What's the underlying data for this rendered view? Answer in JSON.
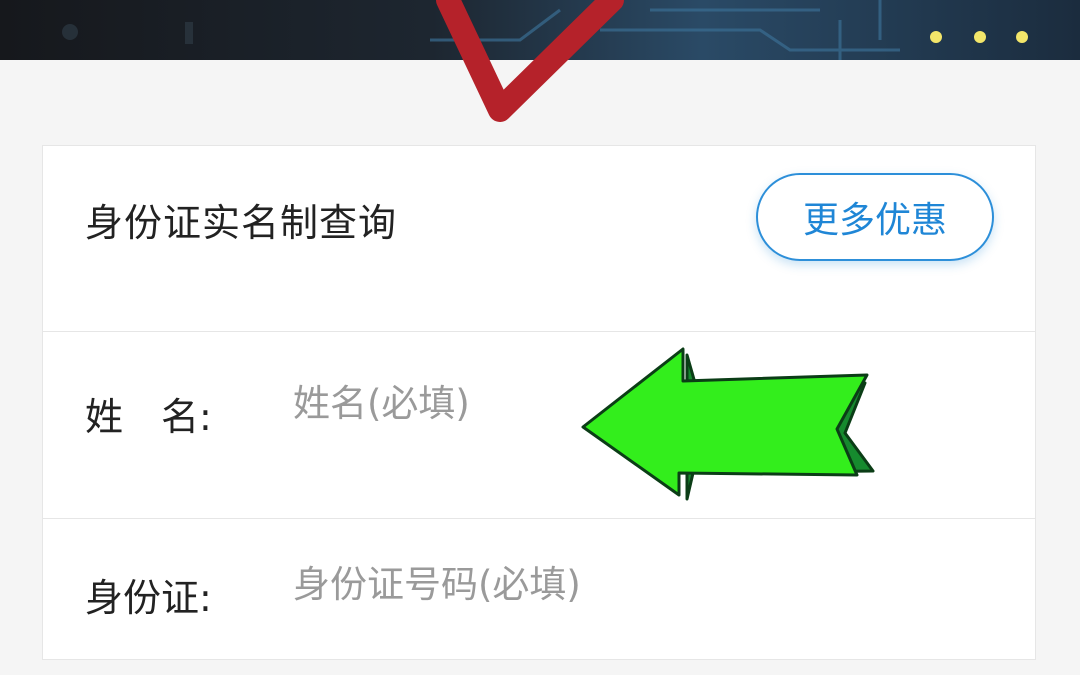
{
  "card": {
    "title": "身份证实名制查询",
    "more_button": "更多优惠"
  },
  "form": {
    "name_label": "姓　名:",
    "name_placeholder": "姓名(必填)",
    "id_label": "身份证:",
    "id_placeholder": "身份证号码(必填)"
  },
  "colors": {
    "accent": "#2d8fd9",
    "arrow": "#22ee22",
    "checkmark": "#b5222a"
  },
  "icons": [
    "banner-image",
    "checkmark-icon",
    "arrow-left-icon"
  ]
}
